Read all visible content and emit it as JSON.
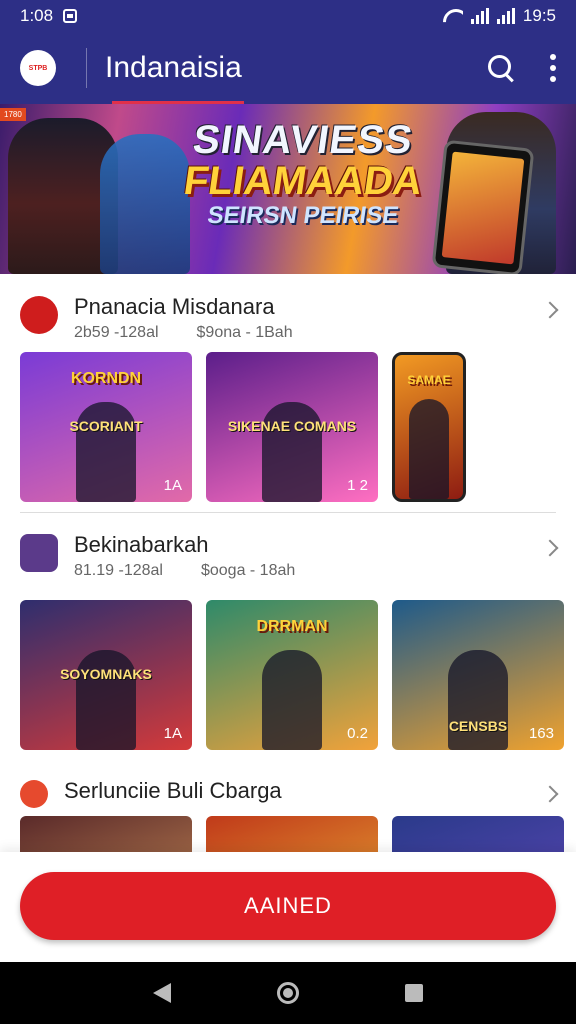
{
  "status_bar": {
    "time_left": "1:08",
    "time_right": "19:5"
  },
  "app_bar": {
    "logo_text": "STPB",
    "title": "Indanaisia"
  },
  "banner": {
    "tag": "1780",
    "line1": "SINAVIESS",
    "line2": "FLIAMAADA",
    "line3": "SEIRSN PEIRISE"
  },
  "sections": [
    {
      "title": "Pnanacia Misdanara",
      "meta1": "2b59 -128al",
      "meta2": "$9ona - 1Bah",
      "logo_color": "#cf1d1d",
      "thumbs": [
        {
          "title": "KORNDN",
          "caption": "SCORIANT",
          "count": "1A",
          "c1": "#7a3bd6",
          "c2": "#e26aa8"
        },
        {
          "title": "",
          "caption": "SIKENAE COMANS",
          "count": "1 2",
          "c1": "#5b1e8a",
          "c2": "#ff6fc1"
        },
        {
          "title": "SAMAE",
          "caption": "",
          "count": "",
          "c1": "#f29a23",
          "c2": "#8e1c12"
        }
      ]
    },
    {
      "title": "Bekinabarkah",
      "meta1": "81.19 -128al",
      "meta2": "$ooga - 18ah",
      "logo_color": "#5b3a8a",
      "thumbs": [
        {
          "title": "",
          "caption": "SOYOMNAKS",
          "count": "1A",
          "c1": "#2e2e6e",
          "c2": "#d43a3a"
        },
        {
          "title": "DRRMAN",
          "caption": "",
          "count": "0.2",
          "c1": "#2e8a6a",
          "c2": "#f2a23a"
        },
        {
          "title": "",
          "caption": "CENSBS",
          "count": "163",
          "c1": "#1e5a8a",
          "c2": "#f0a22e"
        }
      ]
    },
    {
      "title": "Serlunciie Buli Cbarga",
      "meta1": "",
      "meta2": "",
      "logo_color": "#e64a2e",
      "thumbs": [
        {
          "title": "",
          "caption": "",
          "count": "",
          "c1": "#5a2a2a",
          "c2": "#e0a060"
        },
        {
          "title": "",
          "caption": "",
          "count": "",
          "c1": "#c03a1a",
          "c2": "#f2c23a"
        },
        {
          "title": "",
          "caption": "",
          "count": "",
          "c1": "#2a3a8a",
          "c2": "#6a4ac2"
        }
      ]
    }
  ],
  "primary_button": {
    "label": "AAINED"
  }
}
